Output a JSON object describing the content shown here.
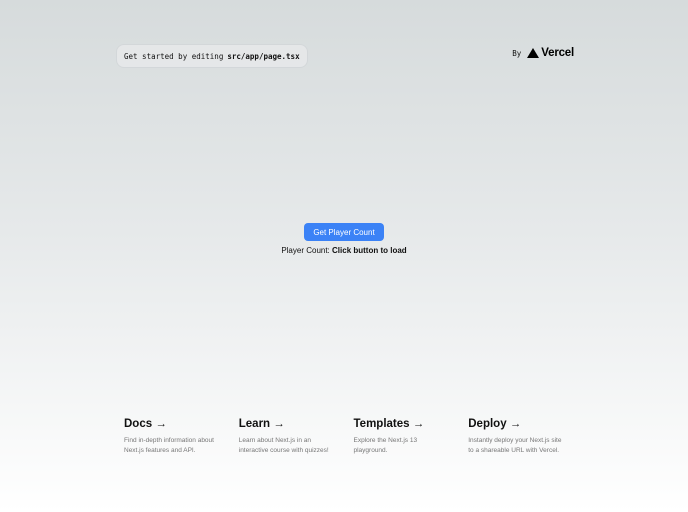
{
  "header": {
    "edit_prefix": "Get started by editing",
    "edit_file": "src/app/page.tsx",
    "by_label": "By",
    "vercel_word": "Vercel",
    "vercel_icon": "vercel-triangle-icon"
  },
  "main": {
    "button_label": "Get Player Count",
    "count_label": "Player Count:",
    "count_value": "Click button to load",
    "accent_color": "#3b82f6"
  },
  "cards": [
    {
      "title": "Docs",
      "arrow": "→",
      "desc": "Find in-depth information about Next.js features and API."
    },
    {
      "title": "Learn",
      "arrow": "→",
      "desc": "Learn about Next.js in an interactive course with quizzes!"
    },
    {
      "title": "Templates",
      "arrow": "→",
      "desc": "Explore the Next.js 13 playground."
    },
    {
      "title": "Deploy",
      "arrow": "→",
      "desc": "Instantly deploy your Next.js site to a shareable URL with Vercel."
    }
  ]
}
